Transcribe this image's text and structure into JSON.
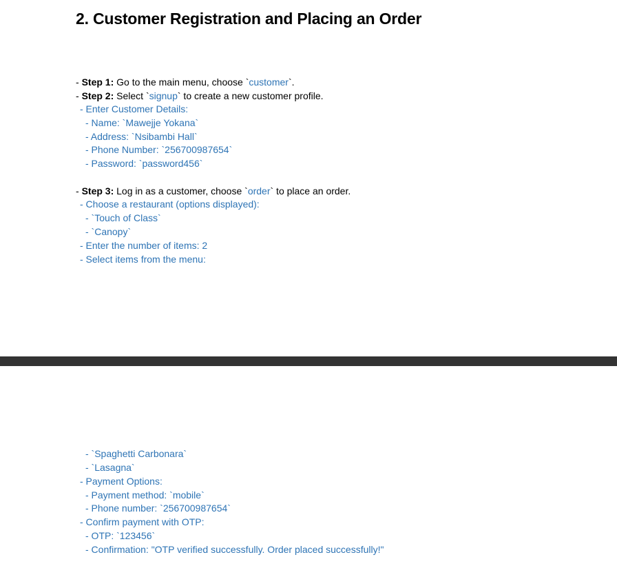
{
  "title": "2. Customer Registration and Placing an Order",
  "step1": {
    "prefix": "- ",
    "label": "Step 1:",
    "text_before": " Go to the main menu, choose `",
    "code": "customer",
    "text_after": "`."
  },
  "step2": {
    "prefix": "- ",
    "label": "Step 2:",
    "text_before": " Select `",
    "code": "signup",
    "text_after": "` to create a new customer profile.",
    "details_heading": "- Enter Customer Details:",
    "name": "- Name: `Mawejje Yokana`",
    "address": "- Address: `Nsibambi Hall`",
    "phone": "- Phone Number: `256700987654`",
    "password": "- Password: `password456`"
  },
  "step3": {
    "prefix": "- ",
    "label": "Step 3:",
    "text_before": " Log in as a customer, choose `",
    "code": "order",
    "text_after": "` to place an order.",
    "choose_restaurant": "- Choose a restaurant (options displayed):",
    "restaurants": [
      "- `Touch of Class`",
      "- `Canopy`"
    ],
    "number_of_items": "- Enter the number of items: 2",
    "select_items": "- Select items from the menu:",
    "items": [
      "- `Spaghetti Carbonara`",
      "- `Lasagna`"
    ],
    "payment_options": "- Payment Options:",
    "payment_method": "- Payment method: `mobile`",
    "payment_phone": "- Phone number: `256700987654`",
    "confirm_otp": "- Confirm payment with OTP:",
    "otp": "- OTP: `123456`",
    "confirmation": "- Confirmation: \"OTP verified successfully. Order placed successfully!\""
  }
}
